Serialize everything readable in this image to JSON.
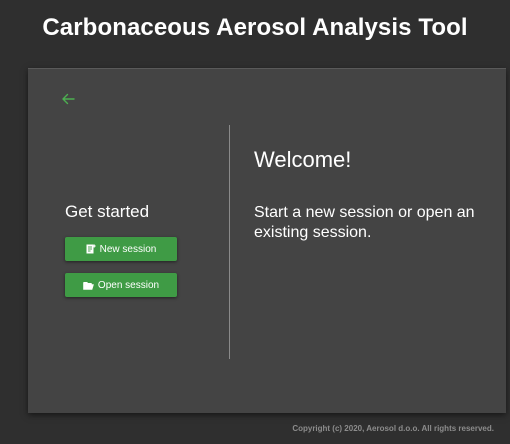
{
  "app": {
    "title": "Carbonaceous Aerosol Analysis Tool"
  },
  "colors": {
    "background": "#2f2f2f",
    "card": "#444444",
    "accent_green": "#3f9b45",
    "back_arrow": "#4caf50",
    "divider": "#8a8a8a",
    "footer_text": "#8c8c8c"
  },
  "left_panel": {
    "back_icon": "arrow-left-icon",
    "heading": "Get started",
    "buttons": [
      {
        "label": "New session",
        "icon": "new-document-icon"
      },
      {
        "label": "Open session",
        "icon": "folder-open-icon"
      }
    ]
  },
  "right_panel": {
    "heading": "Welcome!",
    "text": "Start a new session or open an existing session."
  },
  "footer": {
    "copyright": "Copyright (c) 2020, Aerosol d.o.o. All rights reserved."
  }
}
